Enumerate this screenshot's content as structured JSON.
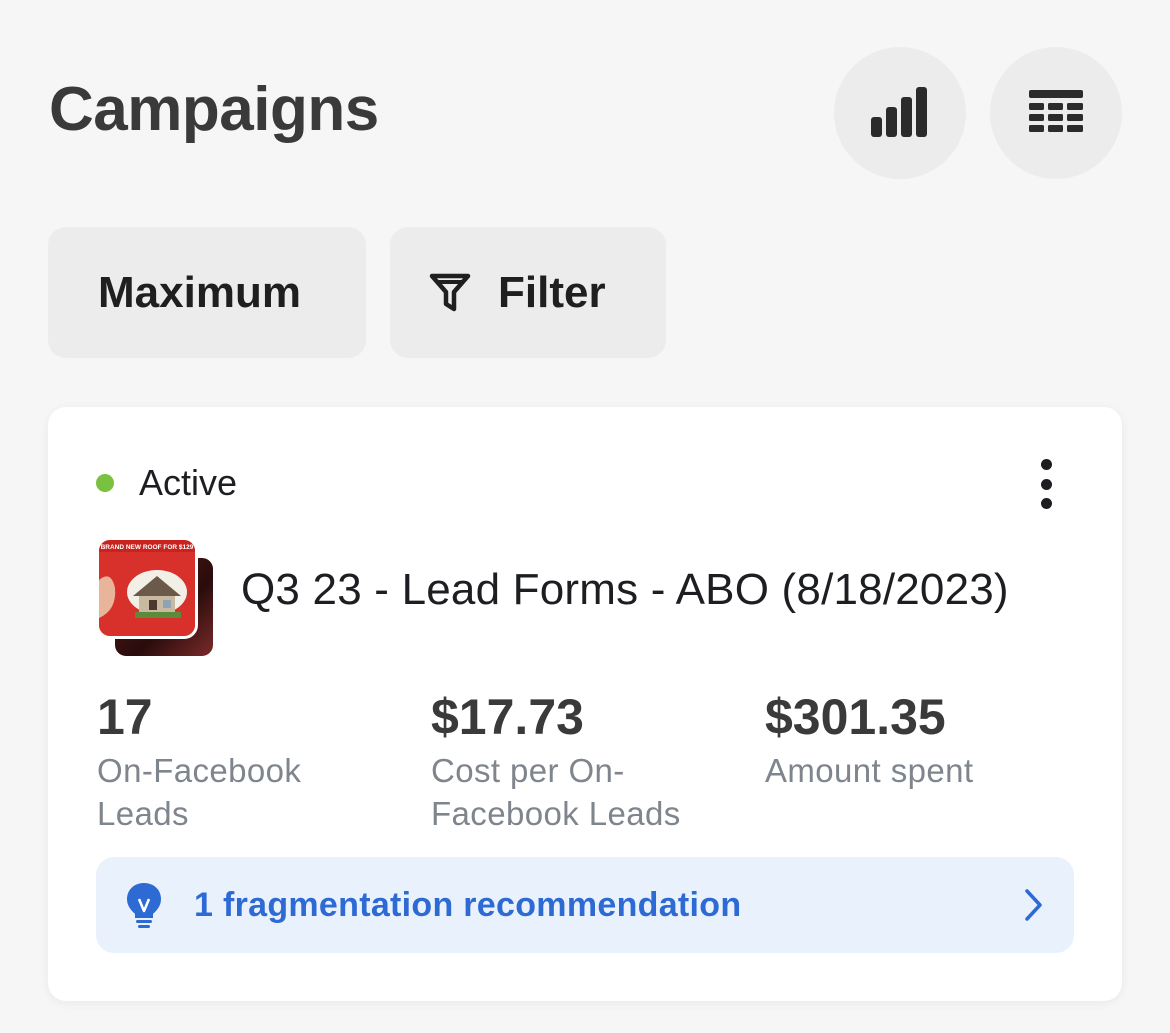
{
  "header": {
    "title": "Campaigns",
    "chart_icon": "bar-chart-icon",
    "table_icon": "table-grid-icon"
  },
  "chips": {
    "maximum_label": "Maximum",
    "filter_label": "Filter",
    "filter_icon": "funnel-icon"
  },
  "campaign": {
    "status": "Active",
    "status_color": "#7ac142",
    "name": "Q3 23 - Lead Forms - ABO (8/18/2023)",
    "thumbnail_caption": "BRAND NEW ROOF FOR $129",
    "metrics": [
      {
        "value": "17",
        "label": "On-Facebook Leads"
      },
      {
        "value": "$17.73",
        "label": "Cost per On-Facebook Leads"
      },
      {
        "value": "$301.35",
        "label": "Amount spent"
      }
    ],
    "recommendation": {
      "text": "1 fragmentation recommendation",
      "icon": "lightbulb-icon",
      "color": "#2d6ad4"
    }
  },
  "colors": {
    "background": "#f6f6f7",
    "chip_background": "#ececed",
    "recommendation_background": "#e9f1fd"
  }
}
